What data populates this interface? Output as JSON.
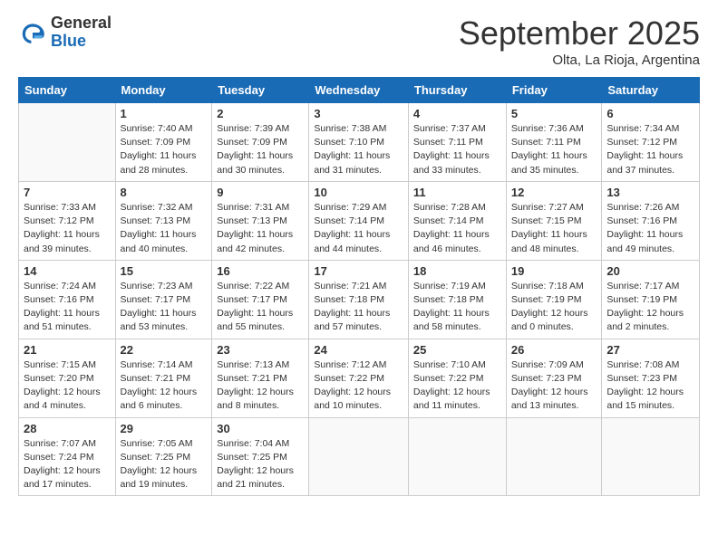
{
  "logo": {
    "general": "General",
    "blue": "Blue"
  },
  "title": "September 2025",
  "location": "Olta, La Rioja, Argentina",
  "days_of_week": [
    "Sunday",
    "Monday",
    "Tuesday",
    "Wednesday",
    "Thursday",
    "Friday",
    "Saturday"
  ],
  "weeks": [
    [
      {
        "day": "",
        "info": ""
      },
      {
        "day": "1",
        "info": "Sunrise: 7:40 AM\nSunset: 7:09 PM\nDaylight: 11 hours and 28 minutes."
      },
      {
        "day": "2",
        "info": "Sunrise: 7:39 AM\nSunset: 7:09 PM\nDaylight: 11 hours and 30 minutes."
      },
      {
        "day": "3",
        "info": "Sunrise: 7:38 AM\nSunset: 7:10 PM\nDaylight: 11 hours and 31 minutes."
      },
      {
        "day": "4",
        "info": "Sunrise: 7:37 AM\nSunset: 7:11 PM\nDaylight: 11 hours and 33 minutes."
      },
      {
        "day": "5",
        "info": "Sunrise: 7:36 AM\nSunset: 7:11 PM\nDaylight: 11 hours and 35 minutes."
      },
      {
        "day": "6",
        "info": "Sunrise: 7:34 AM\nSunset: 7:12 PM\nDaylight: 11 hours and 37 minutes."
      }
    ],
    [
      {
        "day": "7",
        "info": "Sunrise: 7:33 AM\nSunset: 7:12 PM\nDaylight: 11 hours and 39 minutes."
      },
      {
        "day": "8",
        "info": "Sunrise: 7:32 AM\nSunset: 7:13 PM\nDaylight: 11 hours and 40 minutes."
      },
      {
        "day": "9",
        "info": "Sunrise: 7:31 AM\nSunset: 7:13 PM\nDaylight: 11 hours and 42 minutes."
      },
      {
        "day": "10",
        "info": "Sunrise: 7:29 AM\nSunset: 7:14 PM\nDaylight: 11 hours and 44 minutes."
      },
      {
        "day": "11",
        "info": "Sunrise: 7:28 AM\nSunset: 7:14 PM\nDaylight: 11 hours and 46 minutes."
      },
      {
        "day": "12",
        "info": "Sunrise: 7:27 AM\nSunset: 7:15 PM\nDaylight: 11 hours and 48 minutes."
      },
      {
        "day": "13",
        "info": "Sunrise: 7:26 AM\nSunset: 7:16 PM\nDaylight: 11 hours and 49 minutes."
      }
    ],
    [
      {
        "day": "14",
        "info": "Sunrise: 7:24 AM\nSunset: 7:16 PM\nDaylight: 11 hours and 51 minutes."
      },
      {
        "day": "15",
        "info": "Sunrise: 7:23 AM\nSunset: 7:17 PM\nDaylight: 11 hours and 53 minutes."
      },
      {
        "day": "16",
        "info": "Sunrise: 7:22 AM\nSunset: 7:17 PM\nDaylight: 11 hours and 55 minutes."
      },
      {
        "day": "17",
        "info": "Sunrise: 7:21 AM\nSunset: 7:18 PM\nDaylight: 11 hours and 57 minutes."
      },
      {
        "day": "18",
        "info": "Sunrise: 7:19 AM\nSunset: 7:18 PM\nDaylight: 11 hours and 58 minutes."
      },
      {
        "day": "19",
        "info": "Sunrise: 7:18 AM\nSunset: 7:19 PM\nDaylight: 12 hours and 0 minutes."
      },
      {
        "day": "20",
        "info": "Sunrise: 7:17 AM\nSunset: 7:19 PM\nDaylight: 12 hours and 2 minutes."
      }
    ],
    [
      {
        "day": "21",
        "info": "Sunrise: 7:15 AM\nSunset: 7:20 PM\nDaylight: 12 hours and 4 minutes."
      },
      {
        "day": "22",
        "info": "Sunrise: 7:14 AM\nSunset: 7:21 PM\nDaylight: 12 hours and 6 minutes."
      },
      {
        "day": "23",
        "info": "Sunrise: 7:13 AM\nSunset: 7:21 PM\nDaylight: 12 hours and 8 minutes."
      },
      {
        "day": "24",
        "info": "Sunrise: 7:12 AM\nSunset: 7:22 PM\nDaylight: 12 hours and 10 minutes."
      },
      {
        "day": "25",
        "info": "Sunrise: 7:10 AM\nSunset: 7:22 PM\nDaylight: 12 hours and 11 minutes."
      },
      {
        "day": "26",
        "info": "Sunrise: 7:09 AM\nSunset: 7:23 PM\nDaylight: 12 hours and 13 minutes."
      },
      {
        "day": "27",
        "info": "Sunrise: 7:08 AM\nSunset: 7:23 PM\nDaylight: 12 hours and 15 minutes."
      }
    ],
    [
      {
        "day": "28",
        "info": "Sunrise: 7:07 AM\nSunset: 7:24 PM\nDaylight: 12 hours and 17 minutes."
      },
      {
        "day": "29",
        "info": "Sunrise: 7:05 AM\nSunset: 7:25 PM\nDaylight: 12 hours and 19 minutes."
      },
      {
        "day": "30",
        "info": "Sunrise: 7:04 AM\nSunset: 7:25 PM\nDaylight: 12 hours and 21 minutes."
      },
      {
        "day": "",
        "info": ""
      },
      {
        "day": "",
        "info": ""
      },
      {
        "day": "",
        "info": ""
      },
      {
        "day": "",
        "info": ""
      }
    ]
  ]
}
